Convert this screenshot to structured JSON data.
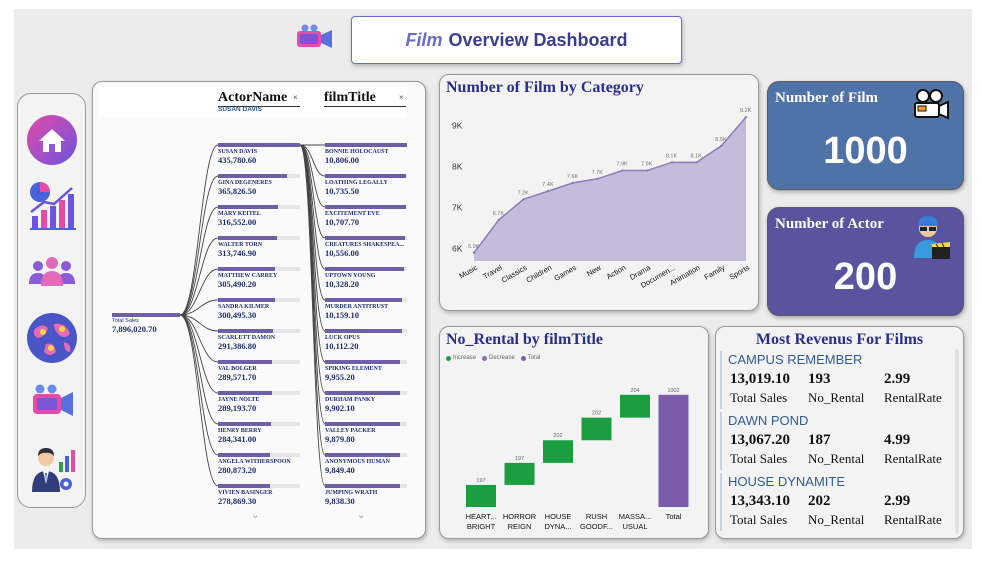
{
  "header": {
    "title_em": "Film",
    "title_rest": "Overview Dashboard"
  },
  "sidebar": {
    "items": [
      {
        "name": "home-icon"
      },
      {
        "name": "analytics-icon"
      },
      {
        "name": "users-icon"
      },
      {
        "name": "globe-icon"
      },
      {
        "name": "film-camera-icon"
      },
      {
        "name": "manager-icon"
      }
    ]
  },
  "decomp": {
    "col1_header": "ActorName",
    "col1_sub": "SUSAN DAVIS",
    "col2_header": "filmTitle",
    "close": "×",
    "root_label": "Total Sales",
    "root_value": "7,896,020.70",
    "actors": [
      {
        "name": "SUSAN DAVIS",
        "value": "435,780.60",
        "pct": 1.0
      },
      {
        "name": "GINA DEGENERES",
        "value": "365,826.50",
        "pct": 0.84
      },
      {
        "name": "MARY KEITEL",
        "value": "316,552.00",
        "pct": 0.73
      },
      {
        "name": "WALTER TORN",
        "value": "313,746.90",
        "pct": 0.72
      },
      {
        "name": "MATTHEW CARREY",
        "value": "305,490.20",
        "pct": 0.7
      },
      {
        "name": "SANDRA KILMER",
        "value": "300,495.30",
        "pct": 0.69
      },
      {
        "name": "SCARLETT DAMON",
        "value": "291,386.80",
        "pct": 0.67
      },
      {
        "name": "VAL BOLGER",
        "value": "289,571.70",
        "pct": 0.66
      },
      {
        "name": "JAYNE NOLTE",
        "value": "289,193.70",
        "pct": 0.66
      },
      {
        "name": "HENRY BERRY",
        "value": "284,341.00",
        "pct": 0.65
      },
      {
        "name": "ANGELA WITHERSPOON",
        "value": "280,873.20",
        "pct": 0.64
      },
      {
        "name": "VIVIEN BASINGER",
        "value": "278,869.30",
        "pct": 0.64
      }
    ],
    "films": [
      {
        "name": "BONNIE HOLOCAUST",
        "value": "10,806.00",
        "pct": 1.0
      },
      {
        "name": "LOATHING LEGALLY",
        "value": "10,735.50",
        "pct": 0.99
      },
      {
        "name": "EXCITEMENT EVE",
        "value": "10,707.70",
        "pct": 0.99
      },
      {
        "name": "CREATURES SHAKESPEA...",
        "value": "10,556.00",
        "pct": 0.98
      },
      {
        "name": "UPTOWN YOUNG",
        "value": "10,328.20",
        "pct": 0.96
      },
      {
        "name": "MURDER ANTITRUST",
        "value": "10,159.10",
        "pct": 0.94
      },
      {
        "name": "LUCK OPUS",
        "value": "10,112.20",
        "pct": 0.94
      },
      {
        "name": "SPIKING ELEMENT",
        "value": "9,955.20",
        "pct": 0.92
      },
      {
        "name": "DURHAM PANKY",
        "value": "9,902.10",
        "pct": 0.92
      },
      {
        "name": "VALLEY PACKER",
        "value": "9,879.80",
        "pct": 0.91
      },
      {
        "name": "ANONYMOUS HUMAN",
        "value": "9,849.40",
        "pct": 0.91
      },
      {
        "name": "JUMPING WRATH",
        "value": "9,838.30",
        "pct": 0.91
      }
    ]
  },
  "category_chart": {
    "title": "Number of Film by Category",
    "chart_data": {
      "type": "area",
      "categories": [
        "Music",
        "Travel",
        "Classics",
        "Children",
        "Games",
        "New",
        "Action",
        "Drama",
        "Documen...",
        "Animation",
        "Family",
        "Sports"
      ],
      "values": [
        5.9,
        6.7,
        7.2,
        7.4,
        7.6,
        7.7,
        7.9,
        7.9,
        8.1,
        8.1,
        8.5,
        9.2
      ],
      "data_labels": [
        "5.9K",
        "6.7K",
        "7.2K",
        "7.4K",
        "7.6K",
        "7.7K",
        "7.9K",
        "7.9K",
        "8.1K",
        "8.1K",
        "8.5K",
        "9.2K"
      ],
      "y_ticks": [
        "9K",
        "8K",
        "7K",
        "6K"
      ],
      "ylim": [
        5.7,
        9.3
      ],
      "fill": "#c5bcdc",
      "stroke": "#8b7db8"
    }
  },
  "kpi": {
    "films_label": "Number of Film",
    "films_value": "1000",
    "actors_label": "Number of Actor",
    "actors_value": "200"
  },
  "waterfall": {
    "title": "No_Rental by filmTitle",
    "legend": [
      "Increase",
      "Decrease",
      "Total"
    ],
    "legend_colors": [
      "#1a9e3f",
      "#8e6bbf",
      "#7a5caa"
    ],
    "chart_data": {
      "type": "bar",
      "categories": [
        "HEART... BRIGHT",
        "HORROR REIGN",
        "HOUSE DYNA...",
        "RUSH GOODF...",
        "MASSA... USUAL",
        "Total"
      ],
      "cat_lines": [
        [
          "HEART...",
          "BRIGHT"
        ],
        [
          "HORROR",
          "REIGN"
        ],
        [
          "HOUSE",
          "DYNA..."
        ],
        [
          "RUSH",
          "GOODF..."
        ],
        [
          "MASSA...",
          "USUAL"
        ],
        [
          "Total",
          ""
        ]
      ],
      "values": [
        197,
        197,
        202,
        202,
        204,
        1002
      ],
      "labels": [
        "197",
        "197",
        "202",
        "202",
        "204",
        "1002"
      ],
      "kinds": [
        "increase",
        "increase",
        "increase",
        "increase",
        "increase",
        "total"
      ]
    }
  },
  "revenue": {
    "title": "Most Revenus For Films",
    "films": [
      {
        "name": "CAMPUS REMEMBER",
        "sales": "13,019.10",
        "rentals": "193",
        "rate": "2.99"
      },
      {
        "name": "DAWN POND",
        "sales": "13,067.20",
        "rentals": "187",
        "rate": "4.99"
      },
      {
        "name": "HOUSE DYNAMITE",
        "sales": "13,343.10",
        "rentals": "202",
        "rate": "2.99"
      }
    ],
    "labels": {
      "sales": "Total Sales",
      "rentals": "No_Rental",
      "rate": "RentalRate"
    }
  },
  "colors": {
    "kpi_blue": "#4f73a6",
    "kpi_purple": "#5a539d",
    "bar_purple": "#6e5fa6",
    "increase": "#1a9e3f",
    "total": "#7a5caa"
  }
}
